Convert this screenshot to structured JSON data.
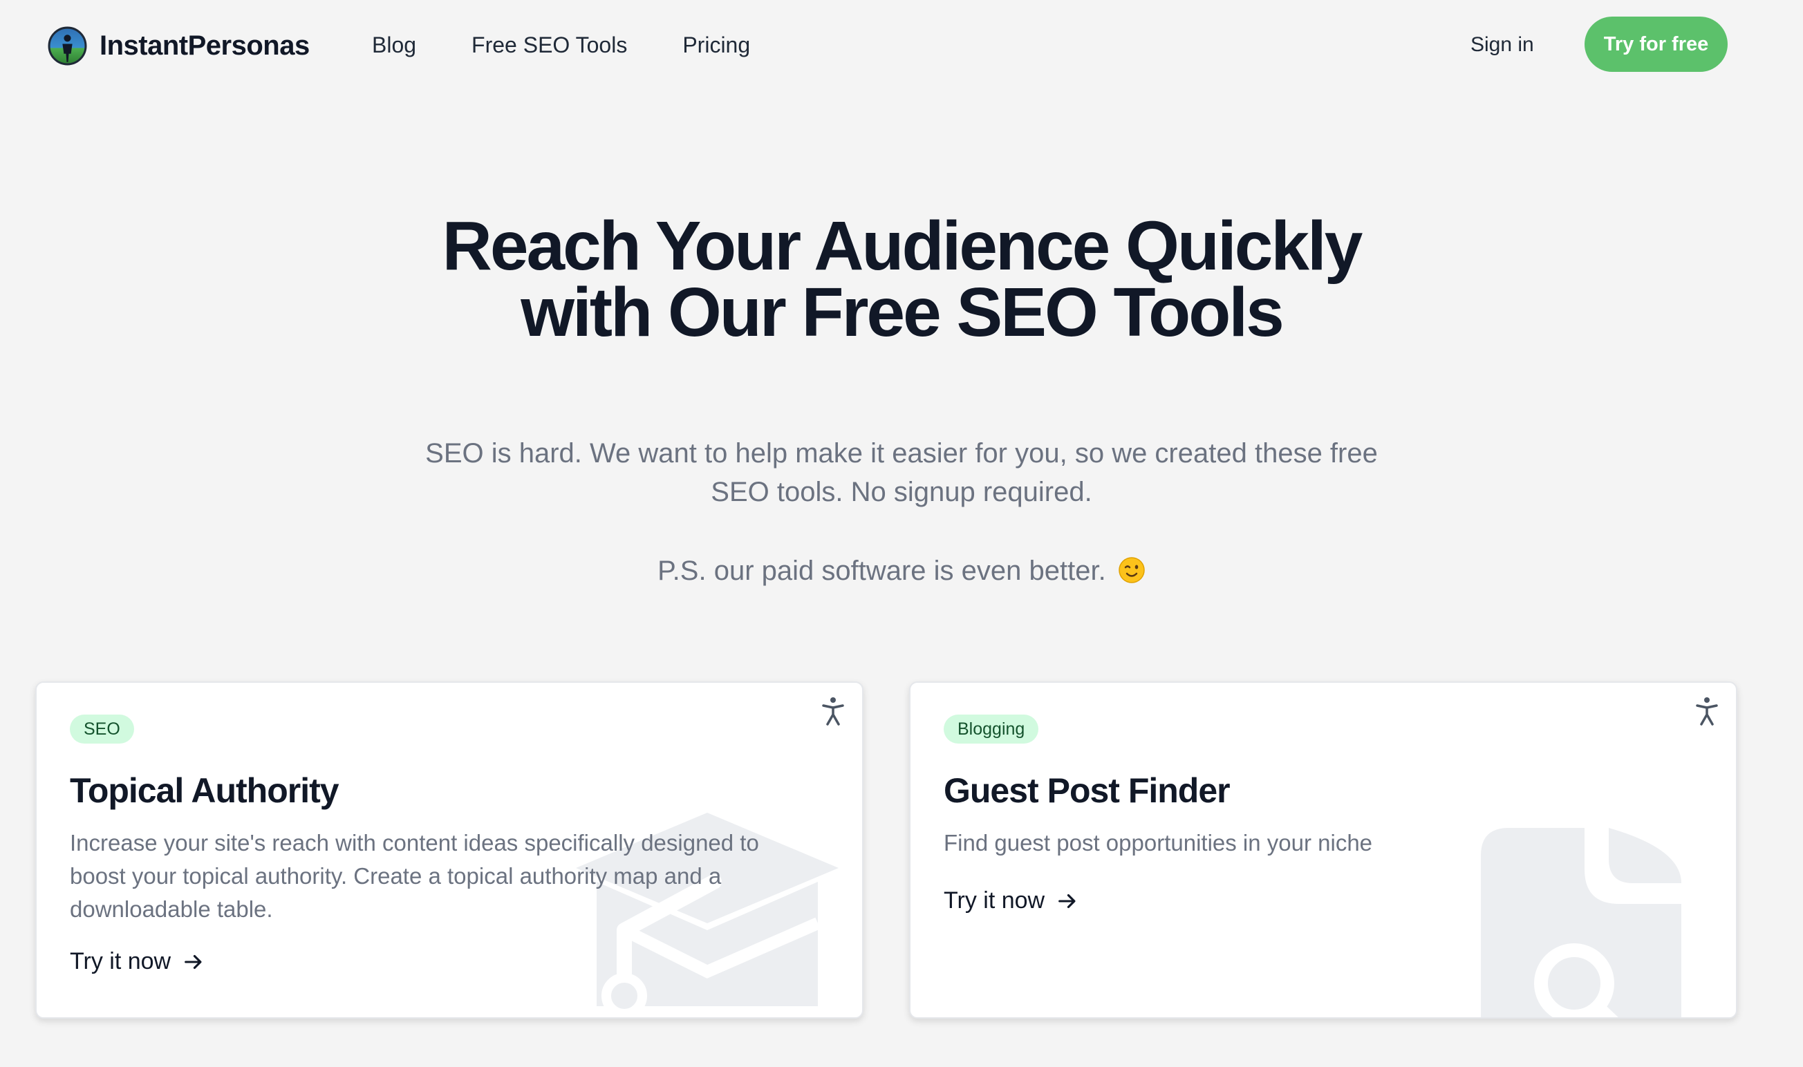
{
  "brand": {
    "name": "InstantPersonas",
    "logo_icon": "persona-logo-icon"
  },
  "nav": {
    "links": [
      {
        "label": "Blog"
      },
      {
        "label": "Free SEO Tools"
      },
      {
        "label": "Pricing"
      }
    ],
    "sign_in": "Sign in",
    "cta": "Try for free",
    "cta_color": "#5cc16b"
  },
  "hero": {
    "title": "Reach Your Audience Quickly with Our Free SEO Tools",
    "subtitle": "SEO is hard. We want to help make it easier for you, so we created these free SEO tools. No signup required.",
    "ps": "P.S. our paid software is even better.",
    "ps_icon": "winking-face-emoji"
  },
  "cards": [
    {
      "badge": "SEO",
      "title": "Topical Authority",
      "description": "Increase your site's reach with content ideas specifically designed to boost your topical authority. Create a topical authority map and a downloadable table.",
      "link": "Try it now",
      "bg_icon": "graduation-cap-icon"
    },
    {
      "badge": "Blogging",
      "title": "Guest Post Finder",
      "description": "Find guest post opportunities in your niche",
      "link": "Try it now",
      "bg_icon": "document-search-icon"
    }
  ],
  "colors": {
    "badge_bg": "#d1fadf",
    "badge_text": "#14532d",
    "page_bg": "#f4f4f4"
  }
}
